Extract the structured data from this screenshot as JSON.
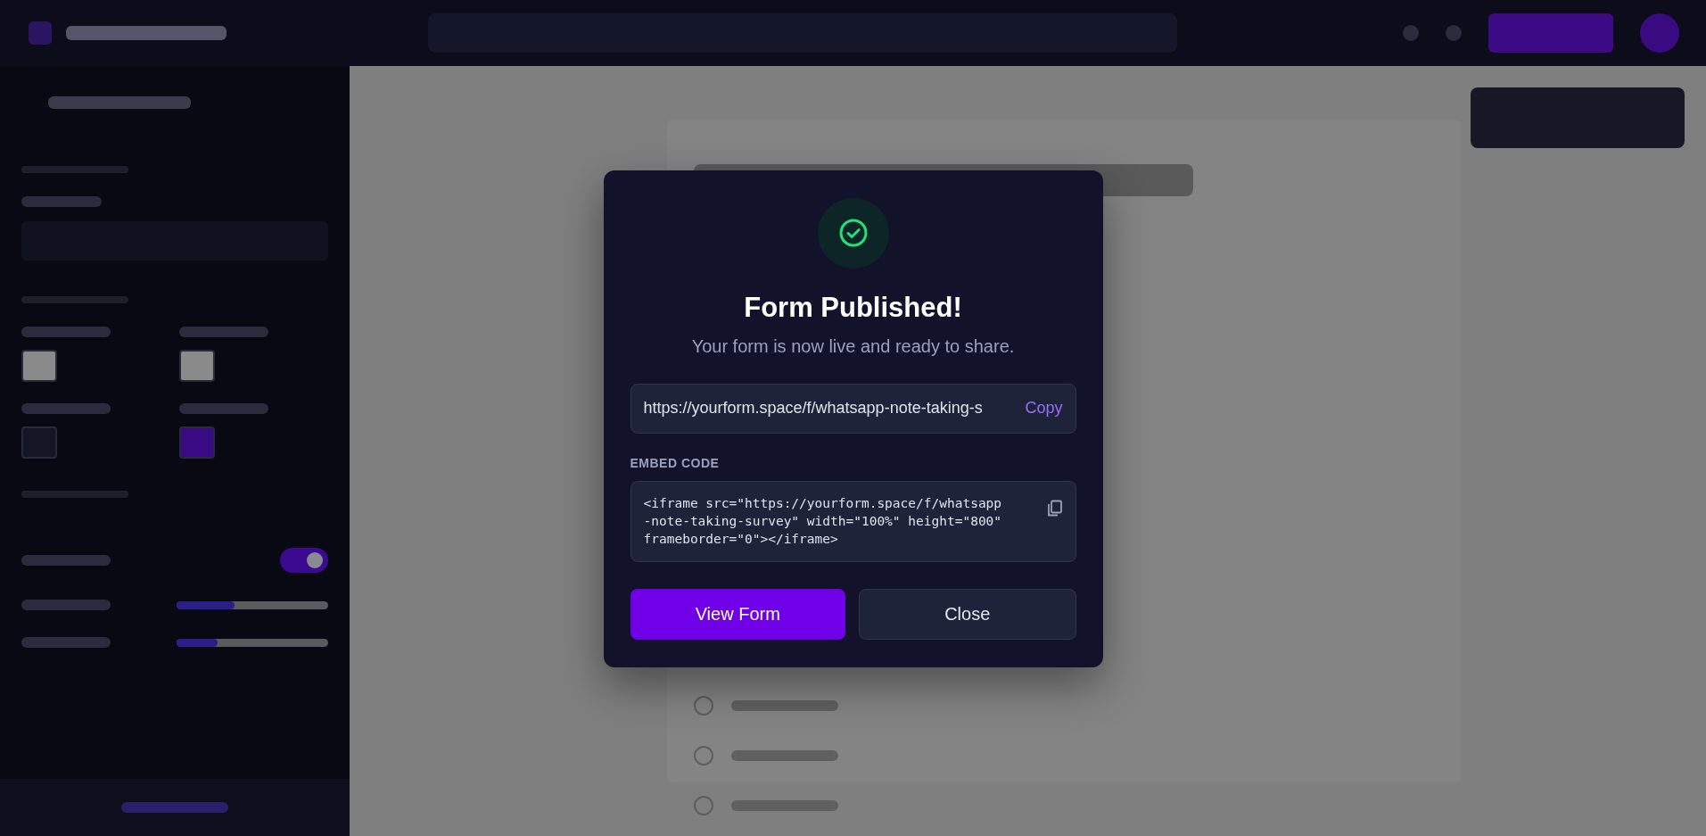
{
  "sidebar": {
    "colors": [
      {
        "color": "#8a8a8a"
      },
      {
        "color": "#8a8a8a"
      },
      {
        "color": "#141626"
      },
      {
        "color": "#3a0a85"
      }
    ],
    "toggle": {
      "on": true
    },
    "sliders": [
      {
        "level": 0.38
      },
      {
        "level": 0.27
      }
    ]
  },
  "form_preview": {
    "options": [
      {
        "selected": false
      },
      {
        "selected": false
      },
      {
        "selected": false
      }
    ]
  },
  "modal": {
    "title": "Form Published!",
    "subtitle": "Your form is now live and ready to share.",
    "url": "https://yourform.space/f/whatsapp-note-taking-s",
    "copy_button": "Copy",
    "embed_label": "EMBED CODE",
    "embed_code": "<iframe src=\"https://yourform.space/f/whatsapp-note-taking-survey\" width=\"100%\" height=\"800\" frameborder=\"0\"></iframe>",
    "buttons": [
      {
        "label": "View Form",
        "kind": "primary"
      },
      {
        "label": "Close",
        "kind": "secondary"
      }
    ]
  }
}
